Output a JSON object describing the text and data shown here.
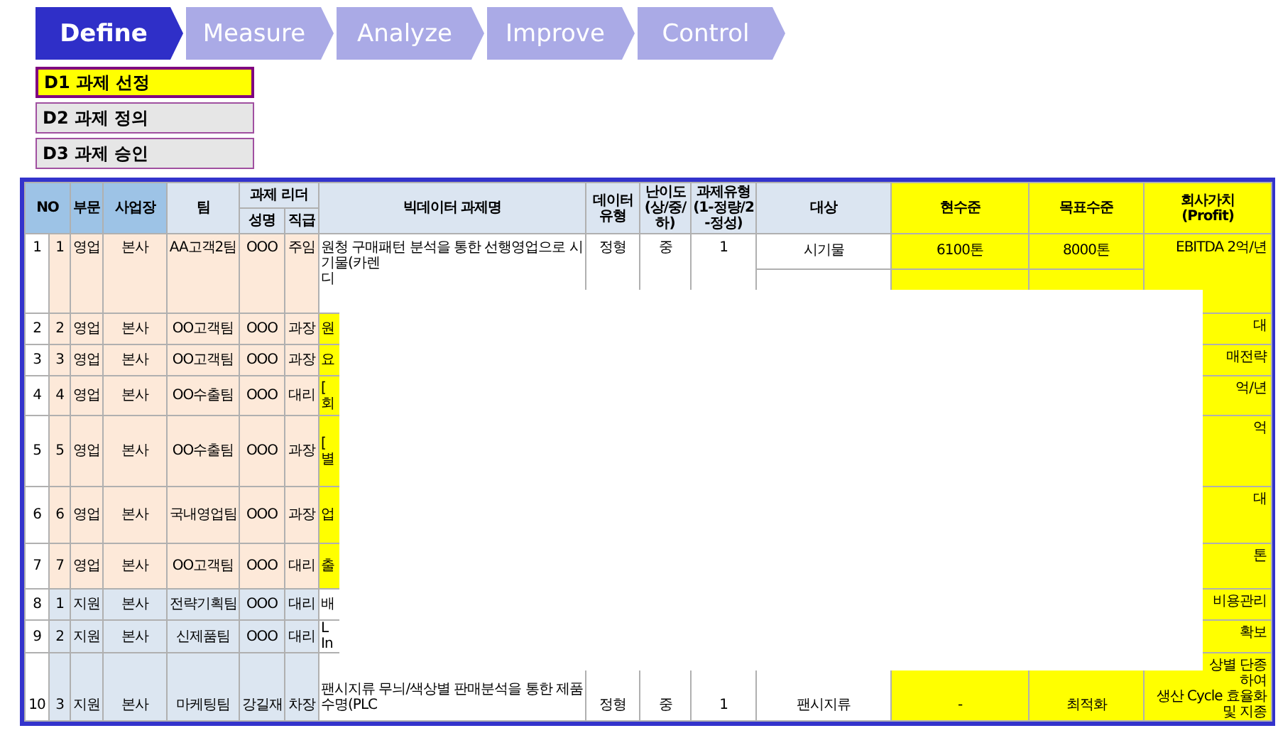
{
  "phases": [
    {
      "label": "Define",
      "selected": true
    },
    {
      "label": "Measure",
      "selected": false
    },
    {
      "label": "Analyze",
      "selected": false
    },
    {
      "label": "Improve",
      "selected": false
    },
    {
      "label": "Control",
      "selected": false
    }
  ],
  "steps": [
    {
      "label": "D1 과제 선정",
      "selected": true
    },
    {
      "label": "D2 과제 정의",
      "selected": false
    },
    {
      "label": "D3 과제 승인",
      "selected": false
    }
  ],
  "table": {
    "headers": {
      "no": "NO",
      "division": "부문",
      "site": "사업장",
      "team": "팀",
      "leader_group": "과제 리더",
      "leader": "성명",
      "rank": "직급",
      "title": "빅데이터 과제명",
      "data_type": [
        "데이터",
        "유형"
      ],
      "difficulty": [
        "난이도",
        "(상/중/하)"
      ],
      "project_type": [
        "과제유형",
        "(1-정량/2-정성)"
      ],
      "target": "대상",
      "current": "현수준",
      "goal": "목표수준",
      "profit": [
        "회사가치",
        "(Profit)"
      ]
    },
    "rows": [
      {
        "no": "1",
        "sub_no": "1",
        "division": "영업",
        "site": "본사",
        "team": "AA고객2팀",
        "leader": "OOO",
        "rank": "주임",
        "title_lines": [
          "원청 구매패턴 분석을 통한 선행영업으로 시기물(카렌",
          "디"
        ],
        "data_type": "정형",
        "difficulty": "중",
        "project_type": "1",
        "target": "시기물",
        "current": "6100톤",
        "goal": "8000톤",
        "profit_lines": [
          "EBITDA 2억/년"
        ],
        "color": "#fde9d9",
        "title_highlight": false
      },
      {
        "no": "2",
        "sub_no": "2",
        "division": "영업",
        "site": "본사",
        "team": "OO고객팀",
        "leader": "OOO",
        "rank": "과장",
        "title_lines": [
          "원"
        ],
        "profit_lines": [
          "대"
        ],
        "color": "#fde9d9",
        "title_highlight": true
      },
      {
        "no": "3",
        "sub_no": "3",
        "division": "영업",
        "site": "본사",
        "team": "OO고객팀",
        "leader": "OOO",
        "rank": "과장",
        "title_lines": [
          "요"
        ],
        "profit_lines": [
          "매전략"
        ],
        "color": "#fde9d9",
        "title_highlight": true
      },
      {
        "no": "4",
        "sub_no": "4",
        "division": "영업",
        "site": "본사",
        "team": "OO수출팀",
        "leader": "OOO",
        "rank": "대리",
        "title_lines": [
          "[",
          "회"
        ],
        "profit_lines": [
          "억/년"
        ],
        "color": "#fde9d9",
        "title_highlight": true
      },
      {
        "no": "5",
        "sub_no": "5",
        "division": "영업",
        "site": "본사",
        "team": "OO수출팀",
        "leader": "OOO",
        "rank": "과장",
        "title_lines": [
          "[",
          "별"
        ],
        "profit_lines": [
          "억"
        ],
        "color": "#fde9d9",
        "title_highlight": true
      },
      {
        "no": "6",
        "sub_no": "6",
        "division": "영업",
        "site": "본사",
        "team": "국내영업팀",
        "leader": "OOO",
        "rank": "과장",
        "title_lines": [
          "업"
        ],
        "profit_lines": [
          "대"
        ],
        "color": "#fde9d9",
        "title_highlight": true
      },
      {
        "no": "7",
        "sub_no": "7",
        "division": "영업",
        "site": "본사",
        "team": "OO고객팀",
        "leader": "OOO",
        "rank": "대리",
        "title_lines": [
          "출"
        ],
        "profit_lines": [
          "톤"
        ],
        "color": "#fde9d9",
        "title_highlight": true
      },
      {
        "no": "8",
        "sub_no": "1",
        "division": "지원",
        "site": "본사",
        "team": "전략기획팀",
        "leader": "OOO",
        "rank": "대리",
        "title_lines": [
          "배"
        ],
        "profit_lines": [
          "비용관리"
        ],
        "color": "#dce6f1",
        "title_highlight": false
      },
      {
        "no": "9",
        "sub_no": "2",
        "division": "지원",
        "site": "본사",
        "team": "신제품팀",
        "leader": "OOO",
        "rank": "대리",
        "title_lines": [
          "L",
          "In"
        ],
        "profit_lines": [
          "확보"
        ],
        "color": "#dce6f1",
        "title_highlight": false
      },
      {
        "no": "10",
        "sub_no": "3",
        "division": "지원",
        "site": "본사",
        "team": "마케팅팀",
        "leader": "강길재",
        "rank": "차장",
        "title_lines": [
          "팬시지류 무늬/색상별 판매분석을 통한 제품수명(PLC"
        ],
        "data_type": "정형",
        "difficulty": "중",
        "project_type": "1",
        "target": "팬시지류",
        "current": "-",
        "goal": "최적화",
        "profit_lines": [
          "상별 단종",
          "하여",
          "생산 Cycle 효율화 및 지종"
        ],
        "color": "#dce6f1",
        "title_highlight": false
      }
    ]
  }
}
